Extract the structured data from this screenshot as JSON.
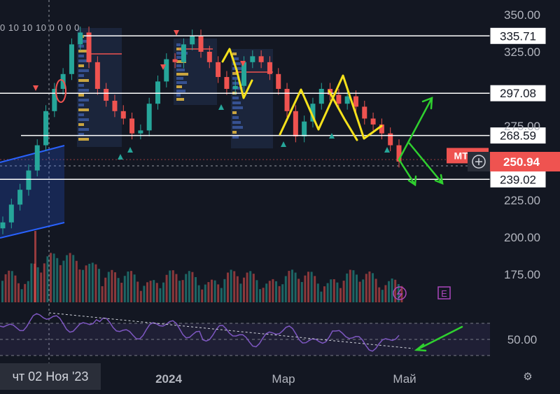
{
  "chart_data": {
    "type": "candlestick",
    "ticker_badge": "MTSS",
    "y_ticks": [
      "350.00",
      "325.00",
      "275.00",
      "225.00",
      "200.00",
      "175.00"
    ],
    "x_ticks": [
      "2024",
      "Мар",
      "Май"
    ],
    "levels": [
      {
        "value": 335.71,
        "label": "335.71",
        "color": "#ffffff"
      },
      {
        "value": 297.08,
        "label": "297.08",
        "color": "#ffffff"
      },
      {
        "value": 268.59,
        "label": "268.59",
        "color": "#ffffff"
      },
      {
        "value": 239.02,
        "label": "239.02",
        "color": "#ffffff"
      }
    ],
    "current_price": {
      "value": 250.94,
      "label": "250.94"
    },
    "rsi": {
      "tick": "50.00",
      "level": 50
    },
    "date_badge": "чт 02 Ноя '23",
    "legend_values": "0 10 10 10   0 0 0 0",
    "up_color": "#26a69a",
    "down_color": "#ef5350",
    "annotation_colors": {
      "yellow": "#f5e11b",
      "green": "#2fd02f",
      "blue": "#2962ff",
      "rsi": "#7e57c2"
    },
    "series": [
      {
        "name": "price",
        "close": [
          210,
          222,
          232,
          245,
          262,
          285,
          300,
          310,
          330,
          338,
          318,
          300,
          292,
          285,
          280,
          270,
          272,
          290,
          305,
          320,
          318,
          330,
          336,
          325,
          318,
          308,
          300,
          302,
          318,
          322,
          318,
          310,
          300,
          285,
          268,
          278,
          290,
          300,
          296,
          290,
          295,
          288,
          280,
          276,
          270,
          262,
          251
        ]
      }
    ]
  },
  "ui": {
    "icons": [
      "lightning-icon",
      "earnings-e-icon",
      "plus-circle-icon",
      "settings-icon"
    ]
  }
}
